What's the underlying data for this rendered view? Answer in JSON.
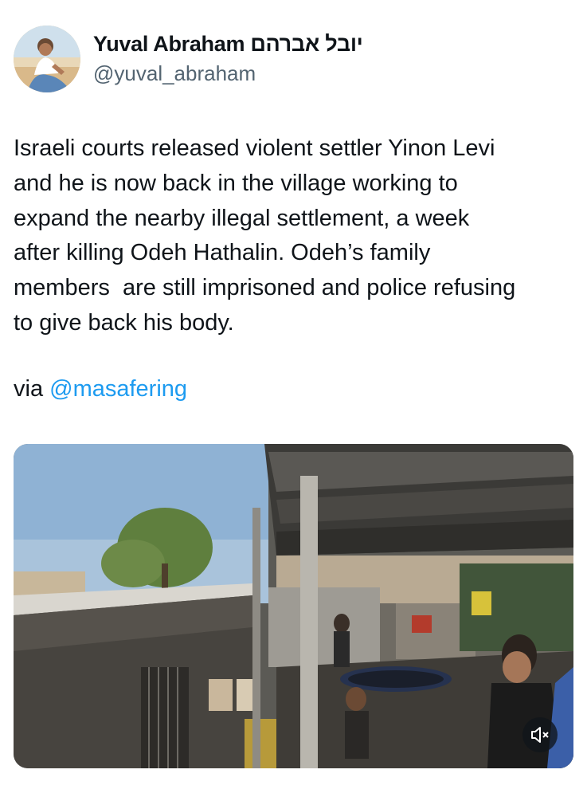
{
  "author": {
    "display_name": "Yuval Abraham יובל אברהם",
    "handle": "@yuval_abraham",
    "avatar_icon": "profile-photo"
  },
  "tweet": {
    "text": "Israeli courts released violent settler Yinon Levi\nand he is now back in the village working to\nexpand the nearby illegal settlement, a week\nafter killing Odeh Hathalin. Odeh’s family\nmembers  are still imprisoned and police refusing\nto give back his body.",
    "via_label": "via",
    "mention": "@masafering"
  },
  "media": {
    "type": "video",
    "mute_icon": "speaker-muted-icon"
  },
  "colors": {
    "link": "#1d9bf0",
    "text": "#0f1419",
    "secondary": "#536471"
  }
}
